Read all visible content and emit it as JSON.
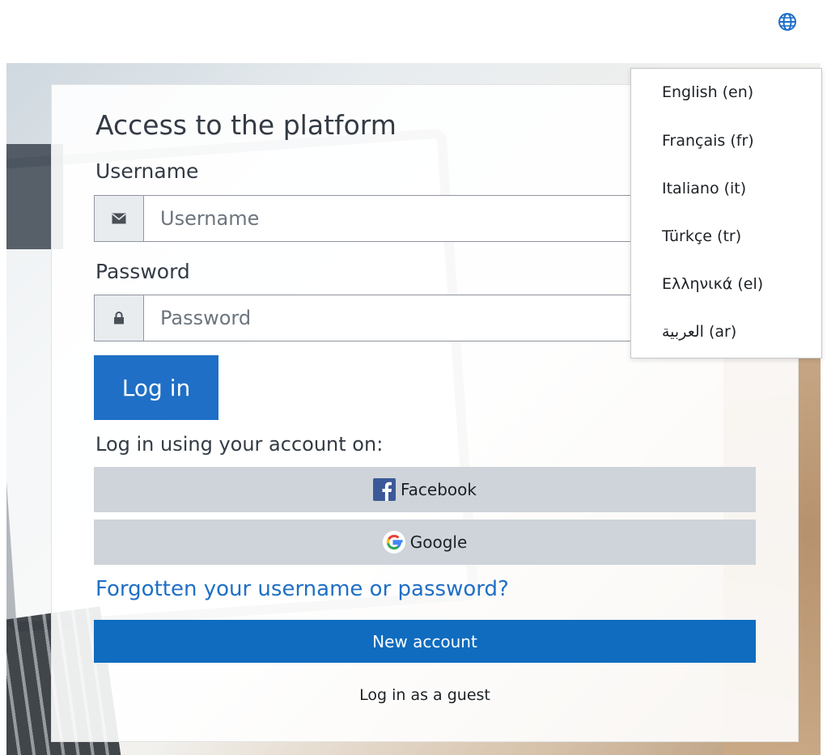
{
  "language_menu": {
    "icon": "globe-icon",
    "items": [
      {
        "label": "English (en)"
      },
      {
        "label": "Français (fr)"
      },
      {
        "label": "Italiano (it)"
      },
      {
        "label": "Türkçe (tr)"
      },
      {
        "label": "Ελληνικά (el)"
      },
      {
        "label": "العربية (ar)"
      }
    ]
  },
  "login": {
    "title": "Access to the platform",
    "username_label": "Username",
    "username_placeholder": "Username",
    "username_value": "",
    "username_icon": "envelope-icon",
    "password_label": "Password",
    "password_placeholder": "Password",
    "password_value": "",
    "password_icon": "lock-icon",
    "submit_label": "Log in",
    "alt_login_label": "Log in using your account on:",
    "providers": [
      {
        "label": "Facebook",
        "icon": "facebook-icon"
      },
      {
        "label": "Google",
        "icon": "google-icon"
      }
    ],
    "forgot_label": "Forgotten your username or password?",
    "new_account_label": "New account",
    "guest_label": "Log in as a guest"
  },
  "colors": {
    "primary": "#0f6cbf",
    "link": "#1f6fc6",
    "provider_bg": "#ced4da",
    "facebook": "#3b5998"
  }
}
